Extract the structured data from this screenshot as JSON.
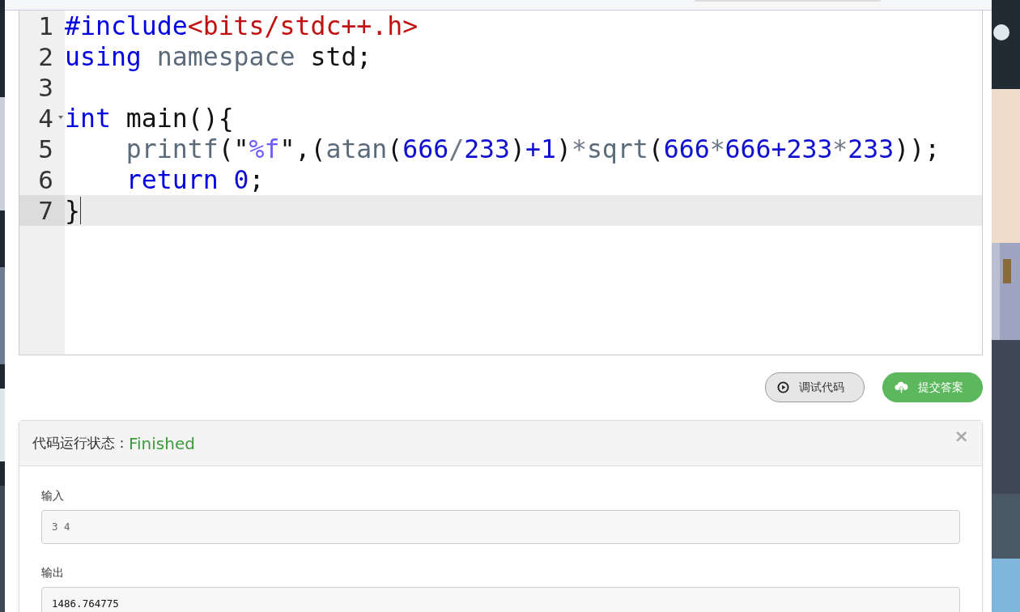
{
  "editor": {
    "lines": [
      {
        "number": "1",
        "foldable": false,
        "active": false,
        "tokens": [
          {
            "kind": "keyword",
            "text": "#include"
          },
          {
            "kind": "string",
            "text": "<bits/stdc++.h>"
          }
        ]
      },
      {
        "number": "2",
        "foldable": false,
        "active": false,
        "tokens": [
          {
            "kind": "keyword",
            "text": "using"
          },
          {
            "kind": "identifier",
            "text": " namespace"
          },
          {
            "kind": "plain",
            "text": " std;"
          }
        ]
      },
      {
        "number": "3",
        "foldable": false,
        "active": false
      },
      {
        "number": "4",
        "foldable": true,
        "active": false,
        "tokens": [
          {
            "kind": "keyword",
            "text": "int"
          },
          {
            "kind": "plain",
            "text": " main(){"
          }
        ]
      },
      {
        "number": "5",
        "foldable": false,
        "active": false,
        "tokens": [
          {
            "kind": "identifier",
            "text": "    printf"
          },
          {
            "kind": "plain",
            "text": "(\""
          },
          {
            "kind": "format",
            "text": "%f"
          },
          {
            "kind": "plain",
            "text": "\","
          },
          {
            "kind": "plain",
            "text": "("
          },
          {
            "kind": "identifier",
            "text": "atan"
          },
          {
            "kind": "plain",
            "text": "("
          },
          {
            "kind": "number",
            "text": "666"
          },
          {
            "kind": "operator",
            "text": "/"
          },
          {
            "kind": "number",
            "text": "233"
          },
          {
            "kind": "plain",
            "text": ")"
          },
          {
            "kind": "number",
            "text": "+1"
          },
          {
            "kind": "plain",
            "text": ")"
          },
          {
            "kind": "operator",
            "text": "*"
          },
          {
            "kind": "identifier",
            "text": "sqrt"
          },
          {
            "kind": "plain",
            "text": "("
          },
          {
            "kind": "number",
            "text": "666"
          },
          {
            "kind": "operator",
            "text": "*"
          },
          {
            "kind": "number",
            "text": "666+233"
          },
          {
            "kind": "operator",
            "text": "*"
          },
          {
            "kind": "number",
            "text": "233"
          },
          {
            "kind": "plain",
            "text": "));"
          }
        ]
      },
      {
        "number": "6",
        "foldable": false,
        "active": false,
        "tokens": [
          {
            "kind": "keyword",
            "text": "    return"
          },
          {
            "kind": "number",
            "text": " 0"
          },
          {
            "kind": "plain",
            "text": ";"
          }
        ]
      },
      {
        "number": "7",
        "foldable": false,
        "active": true,
        "tokens": [
          {
            "kind": "plain",
            "text": "}"
          }
        ]
      }
    ]
  },
  "buttons": [
    {
      "kind": "debug",
      "label": "调试代码"
    },
    {
      "kind": "submit",
      "label": "提交答案"
    }
  ],
  "result_panel": {
    "title": "代码运行状态：",
    "status": "Finished",
    "close": "×",
    "input": {
      "label": "输入",
      "value": "3 4"
    },
    "output": {
      "label": "输出",
      "value": "1486.764775"
    }
  }
}
